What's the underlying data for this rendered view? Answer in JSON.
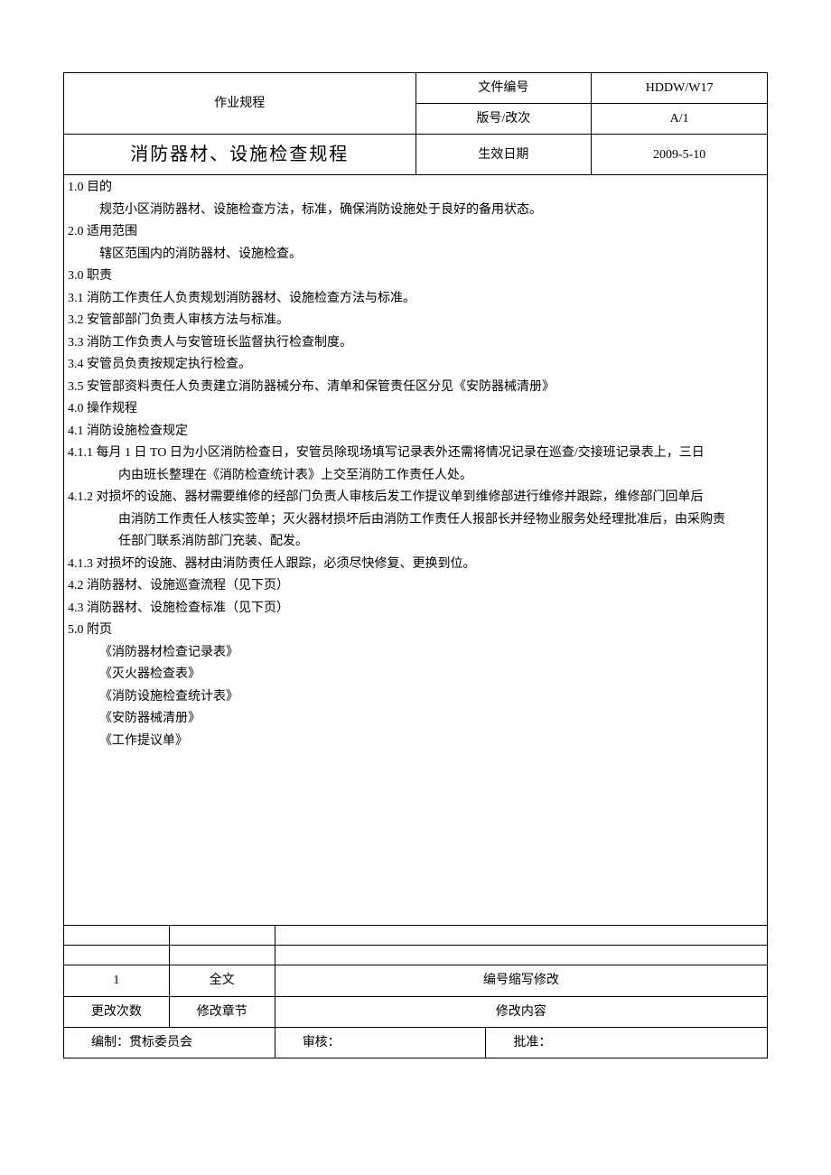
{
  "header": {
    "procedure_label": "作业规程",
    "title": "消防器材、设施检查规程",
    "doc_no_label": "文件编号",
    "doc_no": "HDDW/W17",
    "version_label": "版号/改次",
    "version": "A/1",
    "eff_date_label": "生效日期",
    "eff_date": "2009-5-10"
  },
  "sections": {
    "s1_0": "1.0 目的",
    "s1_0_body": "规范小区消防器材、设施检查方法，标准，确保消防设施处于良好的备用状态。",
    "s2_0": "2.0 适用范围",
    "s2_0_body": "辖区范围内的消防器材、设施检查。",
    "s3_0": "3.0 职责",
    "s3_1": "3.1 消防工作责任人负责规划消防器材、设施检查方法与标准。",
    "s3_2": "3.2 安管部部门负责人审核方法与标准。",
    "s3_3": "3.3 消防工作负责人与安管班长监督执行检查制度。",
    "s3_4": "3.4 安管员负责按规定执行检查。",
    "s3_5": "3.5 安管部资料责任人负责建立消防器械分布、清单和保管责任区分见《安防器械清册》",
    "s4_0": "4.0 操作规程",
    "s4_1": "4.1 消防设施检查规定",
    "s4_1_1": "4.1.1 每月 1 日 TO 日为小区消防检查日，安管员除现场填写记录表外还需将情况记录在巡查/交接班记录表上，三日",
    "s4_1_1b": "内由班长整理在《消防检查统计表》上交至消防工作责任人处。",
    "s4_1_2": "4.1.2 对损坏的设施、器材需要维修的经部门负责人审核后发工作提议单到维修部进行维修并跟踪，维修部门回单后",
    "s4_1_2b": "由消防工作责任人核实签单；灭火器材损坏后由消防工作责任人报部长并经物业服务处经理批准后，由采购责",
    "s4_1_2c": "任部门联系消防部门充装、配发。",
    "s4_1_3": "4.1.3 对损坏的设施、器材由消防责任人跟踪，必须尽快修复、更换到位。",
    "s4_2": "4.2 消防器材、设施巡查流程（见下页）",
    "s4_3": "4.3 消防器材、设施检查标准（见下页）",
    "s5_0": "5.0 附页",
    "att1": "《消防器材检查记录表》",
    "att2": "《灭火器检查表》",
    "att3": "《消防设施检查统计表》",
    "att4": "《安防器械清册》",
    "att5": "《工作提议单》"
  },
  "footer": {
    "row1_col1": "1",
    "row1_col2": "全文",
    "row1_col3": "编号缩写修改",
    "row2_col1": "更改次数",
    "row2_col2": "修改章节",
    "row2_col3": "修改内容",
    "make": "编制：贯标委员会",
    "review": "审核：",
    "approve": "批准："
  }
}
